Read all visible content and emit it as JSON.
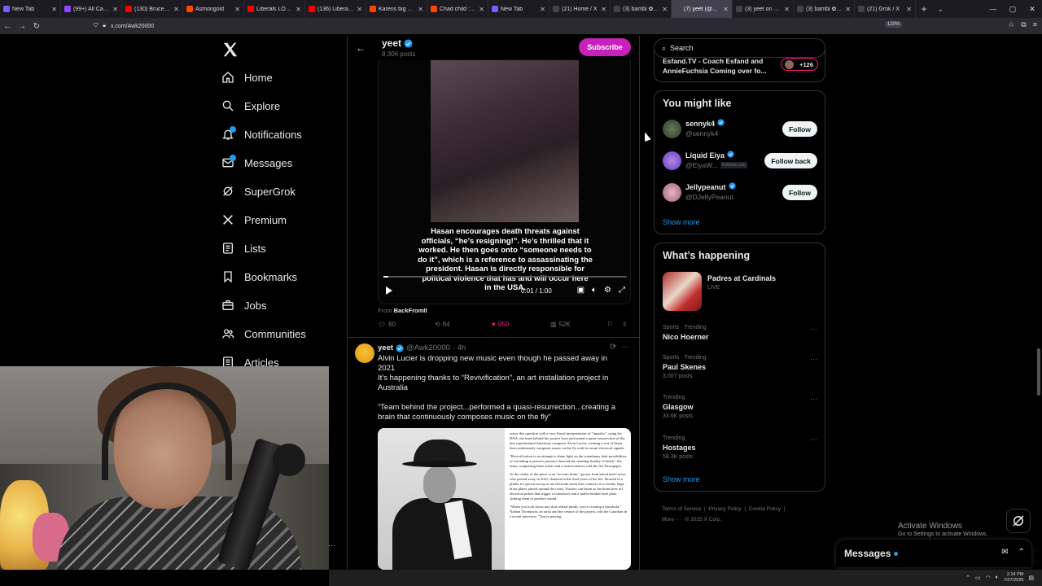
{
  "browser": {
    "tabs": [
      {
        "label": "New Tab",
        "color": "#7b5cff",
        "active": false
      },
      {
        "label": "(99+) All Catego",
        "color": "#9147ff",
        "active": false
      },
      {
        "label": "(130) BruceDropI",
        "color": "#ff0000",
        "active": false
      },
      {
        "label": "Asmongold",
        "color": "#ff4500",
        "active": false
      },
      {
        "label": "Liberals LOSE TH",
        "color": "#ff0000",
        "active": false
      },
      {
        "label": "(136) Liberals LO",
        "color": "#ff0000",
        "active": false
      },
      {
        "label": "Karens big mad c",
        "color": "#ff4500",
        "active": false
      },
      {
        "label": "Chad child : r/As",
        "color": "#ff4500",
        "active": false
      },
      {
        "label": "New Tab",
        "color": "#7b5cff",
        "active": false
      },
      {
        "label": "(21) Home / X",
        "color": "#444444",
        "active": false
      },
      {
        "label": "(3) bambi ✿ che",
        "color": "#444444",
        "active": false
      },
      {
        "label": "(7) yeet (@Awk2",
        "color": "#444444",
        "active": true
      },
      {
        "label": "(3) yeet on X: \"A",
        "color": "#444444",
        "active": false
      },
      {
        "label": "(3) bambi ✿ che",
        "color": "#444444",
        "active": false
      },
      {
        "label": "(21) Grok / X",
        "color": "#444444",
        "active": false
      }
    ],
    "url": "x.com/Awk20000",
    "zoom": "120%"
  },
  "nav": {
    "items": [
      {
        "label": "Home",
        "icon": "home-icon"
      },
      {
        "label": "Explore",
        "icon": "search-icon"
      },
      {
        "label": "Notifications",
        "icon": "bell-icon",
        "badge": true
      },
      {
        "label": "Messages",
        "icon": "mail-icon",
        "badge": true
      },
      {
        "label": "SuperGrok",
        "icon": "grok-icon"
      },
      {
        "label": "Premium",
        "icon": "x-icon"
      },
      {
        "label": "Lists",
        "icon": "list-icon"
      },
      {
        "label": "Bookmarks",
        "icon": "bookmark-icon"
      },
      {
        "label": "Jobs",
        "icon": "briefcase-icon"
      },
      {
        "label": "Communities",
        "icon": "people-icon"
      },
      {
        "label": "Articles",
        "icon": "article-icon"
      }
    ]
  },
  "header": {
    "name": "yeet",
    "posts": "8,306 posts",
    "subscribe": "Subscribe"
  },
  "post1": {
    "caption": "Hasan encourages death threats against officials, “he’s resigning!”. He’s thrilled that it worked. He then goes onto “someone needs to do it”, which is a reference to assassinating the president. Hasan is directly responsible for political violence that has and will occur here in the USA.",
    "time": "0:01 / 1:00",
    "progress_fraction": 0.02,
    "from_label": "From",
    "from_source": "BackFromIt",
    "replies": "60",
    "reposts": "64",
    "likes": "950",
    "views": "52K"
  },
  "post2": {
    "name": "yeet",
    "handle": "@Awk20000",
    "time": "· 4h",
    "line1": "Alvin Lucier is dropping new music even though he passed away in 2021",
    "line2": "It’s happening thanks to “Revivification”, an art installation project in Australia",
    "line3": "“Team behind the project...performed a quasi-resurrection...creating a brain that continuously composes music on the fly”",
    "article_paragraphs": [
      "raises this question with a very literal interpretation of \"impulse\": using his DNA, the team behind the project have performed a quasi-resurrection of the late experimental American composer Alvin Lucier, creating a sort of brain that continuously composes music on the fly with its errant electrical signals.",
      "\"Revivification is an attempt to shine light on the sometimes dark possibilities of extending a person's presence beyond the seeming finality of death,\" the team, comprising three artists and a neuroscientist, told the Art Newspaper.",
      "At the center of the piece is an \"in-vitro brain,\" grown from blood that Lucier, who passed away in 2021, donated in the final years of his life. Housed in a plinth, it's grown on top of an electrode mesh that connects it to twenty large brass plates placed around the room. Visitors can listen as the brain fires off electrical pulses that trigger a transducer and a mallet behind each plate, striking them to produce sound.",
      "\"When you look down into that central plinth, you're creating a threshold,\" Nathan Thompson, an artist and the creator of the project, told the Guardian in a recent interview. \"You're peering"
    ]
  },
  "search": {
    "placeholder": "Search"
  },
  "topcard": {
    "line1": "Esfand.TV - Coach Esfand and",
    "line2": "AnnieFuchsia Coming over fo...",
    "count": "+126"
  },
  "might_like": {
    "title": "You might like",
    "users": [
      {
        "name": "sennyk4",
        "handle": "@sennyk4",
        "button": "Follow",
        "follows_you": ""
      },
      {
        "name": "Liquid Eiya",
        "handle": "@EiyaW...",
        "button": "Follow back",
        "follows_you": "Follows you"
      },
      {
        "name": "Jellypeanut",
        "handle": "@DJellyPeanut",
        "button": "Follow",
        "follows_you": ""
      }
    ],
    "show_more": "Show more"
  },
  "happening": {
    "title": "What’s happening",
    "event_title": "Padres at Cardinals",
    "event_status": "LIVE",
    "trends": [
      {
        "meta": "Sports · Trending",
        "name": "Nico Hoerner",
        "count": ""
      },
      {
        "meta": "Sports · Trending",
        "name": "Paul Skenes",
        "count": "3,007 posts"
      },
      {
        "meta": "Trending",
        "name": "Glasgow",
        "count": "33.6K posts"
      },
      {
        "meta": "Trending",
        "name": "Hostages",
        "count": "58.3K posts"
      }
    ],
    "show_more": "Show more"
  },
  "footer": {
    "links": [
      "Terms of Service",
      "Privacy Policy",
      "Cookie Policy"
    ],
    "more": "More ···",
    "copyright": "© 2025 X Corp."
  },
  "activate": {
    "line1": "Activate Windows",
    "line2": "Go to Settings to activate Windows."
  },
  "messages_drawer": {
    "title": "Messages"
  },
  "taskbar": {
    "time": "2:14 PM",
    "date": "7/27/2025"
  }
}
